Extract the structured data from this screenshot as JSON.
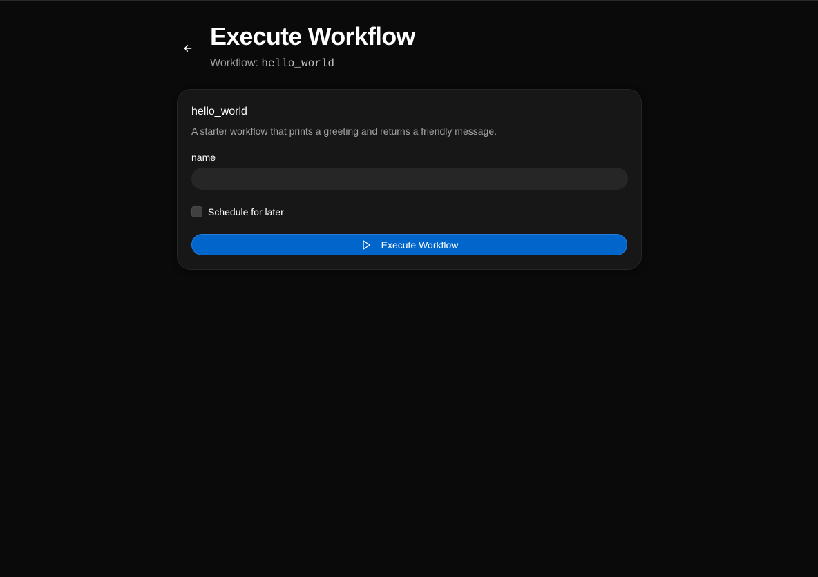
{
  "header": {
    "title": "Execute Workflow",
    "subtitle_prefix": "Workflow:",
    "workflow_id": "hello_world",
    "back_icon": "arrow-left-icon"
  },
  "card": {
    "title": "hello_world",
    "description": "A starter workflow that prints a greeting and returns a friendly message.",
    "field_label": "name",
    "name_value": "",
    "name_placeholder": "",
    "schedule_label": "Schedule for later",
    "schedule_checked": false,
    "execute_label": "Execute Workflow",
    "execute_icon": "play-icon"
  },
  "colors": {
    "background": "#0a0a0a",
    "card": "#171717",
    "input": "#262626",
    "accent": "#0066cc",
    "muted_text": "#a3a3a3"
  }
}
